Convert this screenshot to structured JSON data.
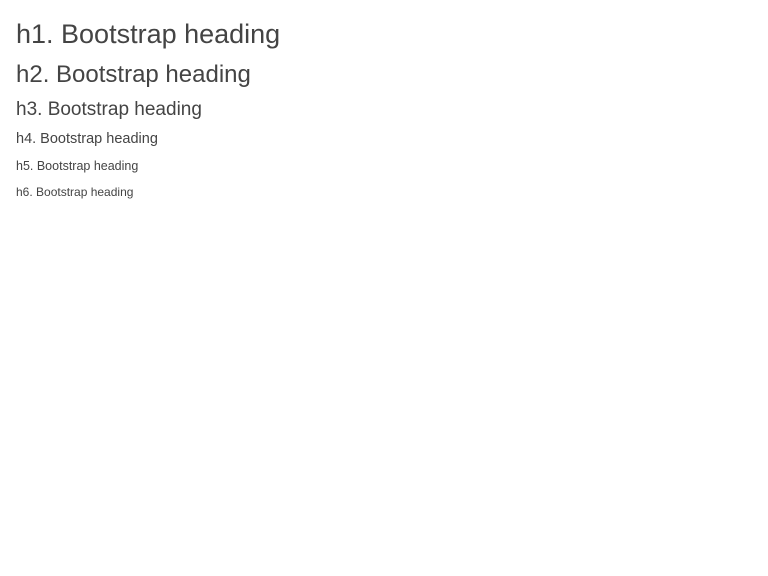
{
  "headings": {
    "h1": "h1. Bootstrap heading",
    "h2": "h2. Bootstrap heading",
    "h3": "h3. Bootstrap heading",
    "h4": "h4. Bootstrap heading",
    "h5": "h5. Bootstrap heading",
    "h6": "h6. Bootstrap heading"
  },
  "colors": {
    "background": "#ffffff",
    "text": "#444444"
  }
}
